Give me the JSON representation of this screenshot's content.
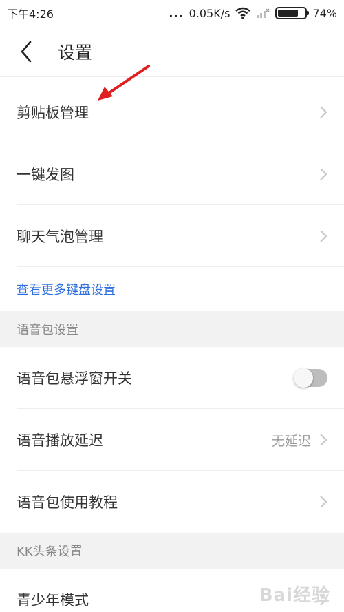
{
  "status": {
    "time": "下午4:26",
    "dots": "...",
    "speed": "0.05K/s",
    "battery": "74%",
    "battery_level": 0.74
  },
  "header": {
    "title": "设置"
  },
  "items": {
    "clipboard": "剪贴板管理",
    "one_key_image": "一键发图",
    "chat_bubble": "聊天气泡管理",
    "more_keyboard_link": "查看更多键盘设置",
    "voice_section": "语音包设置",
    "voice_float": "语音包悬浮窗开关",
    "voice_delay": "语音播放延迟",
    "voice_delay_value": "无延迟",
    "voice_tutorial": "语音包使用教程",
    "kk_section": "KK头条设置",
    "youth_mode": "青少年模式"
  },
  "toggles": {
    "voice_float_on": false
  },
  "colors": {
    "link": "#2f6fdf",
    "annotation_arrow": "#e02020",
    "section_bg": "#f2f2f2"
  },
  "watermark": "Bai经验"
}
